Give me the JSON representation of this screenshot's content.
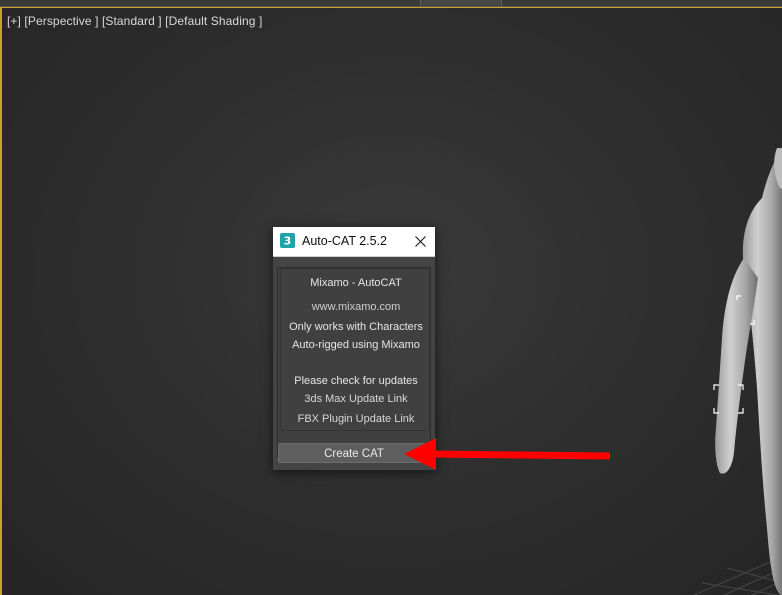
{
  "viewport": {
    "label": "[+] [Perspective ] [Standard ] [Default Shading ]"
  },
  "dialog": {
    "title": "Auto-CAT 2.5.2",
    "app_icon_glyph": "3",
    "lines": {
      "heading": "Mixamo - AutoCAT",
      "website": "www.mixamo.com",
      "note_1": "Only works with Characters",
      "note_2": "Auto-rigged using Mixamo",
      "updates": "Please check for updates",
      "max_link": "3ds Max Update Link",
      "fbx_link": "FBX Plugin Update Link"
    },
    "create_button": "Create CAT"
  },
  "colors": {
    "viewport_border": "#c9a227",
    "arrow": "#ff0000",
    "app_icon": "#1fa3a8"
  }
}
